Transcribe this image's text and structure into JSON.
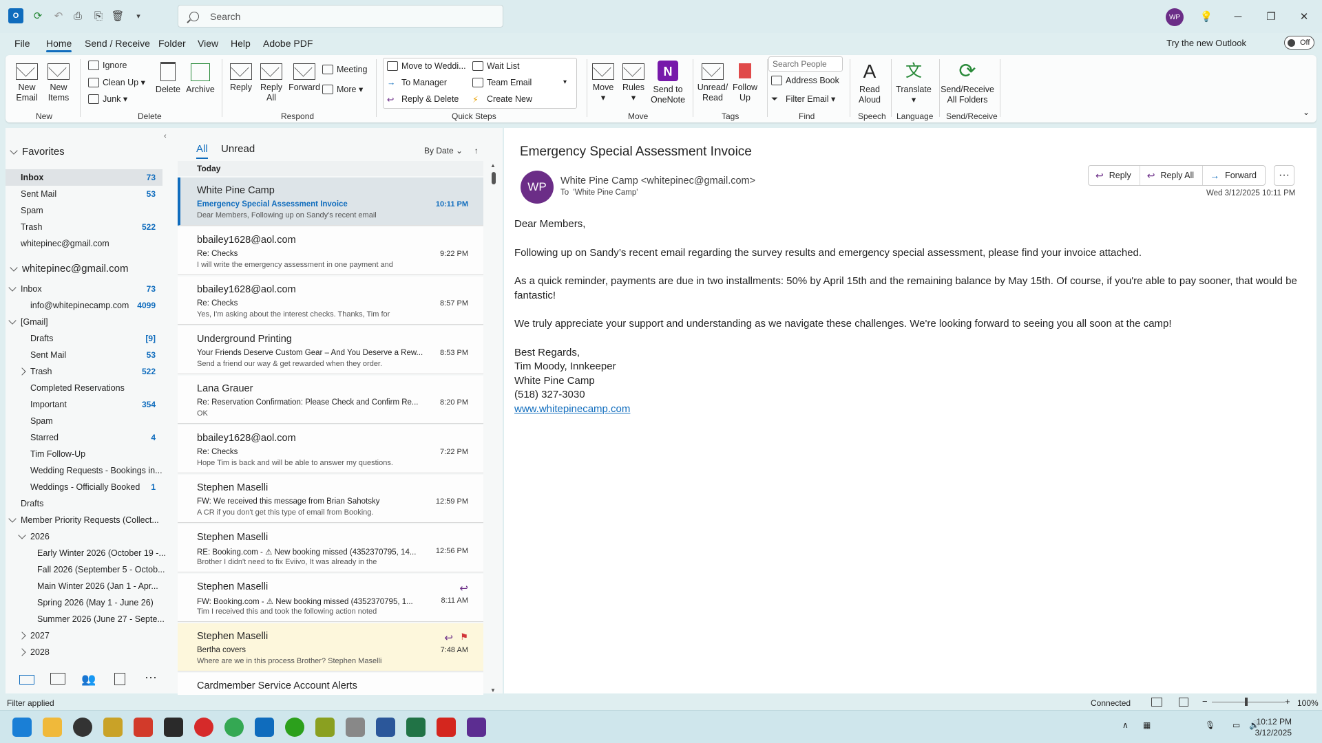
{
  "titlebar": {
    "search_placeholder": "Search",
    "avatar_initials": "WP"
  },
  "menu": {
    "items": [
      "File",
      "Home",
      "Send / Receive",
      "Folder",
      "View",
      "Help",
      "Adobe PDF"
    ],
    "active": "Home",
    "try_new": "Try the new Outlook",
    "toggle": "Off"
  },
  "ribbon": {
    "new_email": "New\nEmail",
    "new_items": "New\nItems",
    "ignore": "Ignore",
    "clean_up": "Clean Up",
    "junk": "Junk",
    "delete": "Delete",
    "archive": "Archive",
    "reply": "Reply",
    "reply_all": "Reply\nAll",
    "forward": "Forward",
    "meeting": "Meeting",
    "more": "More",
    "qs_move": "Move to Weddi...",
    "qs_manager": "To Manager",
    "qs_reply_delete": "Reply & Delete",
    "qs_wait": "Wait List",
    "qs_team": "Team Email",
    "qs_create": "Create New",
    "move": "Move",
    "rules": "Rules",
    "onenote": "Send to\nOneNote",
    "unread": "Unread/\nRead",
    "follow": "Follow\nUp",
    "search_people": "Search People",
    "address_book": "Address Book",
    "filter_email": "Filter Email",
    "read_aloud": "Read\nAloud",
    "translate": "Translate",
    "send_receive": "Send/Receive\nAll Folders",
    "groups": [
      "New",
      "Delete",
      "Respond",
      "Quick Steps",
      "Move",
      "Tags",
      "Find",
      "Speech",
      "Language",
      "Send/Receive"
    ]
  },
  "nav": {
    "favorites": "Favorites",
    "fav_items": [
      {
        "label": "Inbox",
        "count": "73"
      },
      {
        "label": "Sent Mail",
        "count": "53"
      },
      {
        "label": "Spam",
        "count": ""
      },
      {
        "label": "Trash",
        "count": "522"
      },
      {
        "label": "whitepinec@gmail.com",
        "count": ""
      }
    ],
    "account": "whitepinec@gmail.com",
    "acct_items": [
      {
        "label": "Inbox",
        "count": "73"
      },
      {
        "label": "info@whitepinecamp.com",
        "count": "4099"
      },
      {
        "label": "[Gmail]",
        "count": ""
      },
      {
        "label": "Drafts",
        "count": "[9]"
      },
      {
        "label": "Sent Mail",
        "count": "53"
      },
      {
        "label": "Trash",
        "count": "522"
      },
      {
        "label": "Completed Reservations",
        "count": ""
      },
      {
        "label": "Important",
        "count": "354"
      },
      {
        "label": "Spam",
        "count": ""
      },
      {
        "label": "Starred",
        "count": "4"
      },
      {
        "label": "Tim Follow-Up",
        "count": ""
      },
      {
        "label": "Wedding Requests - Bookings in...",
        "count": ""
      },
      {
        "label": "Weddings - Officially Booked",
        "count": "1"
      },
      {
        "label": "Drafts",
        "count": ""
      },
      {
        "label": "Member Priority Requests (Collect...",
        "count": ""
      },
      {
        "label": "2026",
        "count": ""
      },
      {
        "label": "Early Winter 2026 (October 19 -...",
        "count": ""
      },
      {
        "label": "Fall 2026 (September 5 - Octob...",
        "count": ""
      },
      {
        "label": "Main Winter 2026 (Jan 1 - Apr...",
        "count": ""
      },
      {
        "label": "Spring 2026 (May 1 - June 26)",
        "count": ""
      },
      {
        "label": "Summer 2026 (June 27 - Septe...",
        "count": ""
      },
      {
        "label": "2027",
        "count": ""
      },
      {
        "label": "2028",
        "count": ""
      }
    ]
  },
  "list": {
    "tab_all": "All",
    "tab_unread": "Unread",
    "sort": "By Date",
    "group_today": "Today",
    "messages": [
      {
        "sender": "White Pine Camp",
        "subject": "Emergency Special Assessment Invoice",
        "preview": "Dear Members,  Following up on Sandy's recent email",
        "time": "10:11 PM"
      },
      {
        "sender": "bbailey1628@aol.com",
        "subject": "Re: Checks",
        "preview": "I will write the emergency assessment in one payment  and",
        "time": "9:22 PM"
      },
      {
        "sender": "bbailey1628@aol.com",
        "subject": "Re: Checks",
        "preview": "Yes, I'm asking about the interest checks.  Thanks, Tim for",
        "time": "8:57 PM"
      },
      {
        "sender": "Underground Printing",
        "subject": "Your Friends Deserve Custom Gear – And You Deserve a Rew...",
        "preview": "Send a friend our way & get rewarded when they order.",
        "time": "8:53 PM"
      },
      {
        "sender": "Lana Grauer",
        "subject": "Re: Reservation Confirmation: Please Check and Confirm Re...",
        "preview": "OK",
        "time": "8:20 PM"
      },
      {
        "sender": "bbailey1628@aol.com",
        "subject": "Re: Checks",
        "preview": "Hope Tim is back and will be able to answer my questions.",
        "time": "7:22 PM"
      },
      {
        "sender": "Stephen Maselli",
        "subject": "FW: We received this message from Brian Sahotsky",
        "preview": "A CR if you don't get this type of email from Booking.",
        "time": "12:59 PM"
      },
      {
        "sender": "Stephen Maselli",
        "subject": "RE: Booking.com - ⚠ New booking missed (4352370795, 14...",
        "preview": "Brother I didn't need to fix Eviivo,  It was already in the",
        "time": "12:56 PM"
      },
      {
        "sender": "Stephen Maselli",
        "subject": "FW: Booking.com - ⚠ New booking missed (4352370795, 1...",
        "preview": "Tim I received this and took the following action noted",
        "time": "8:11 AM"
      },
      {
        "sender": "Stephen Maselli",
        "subject": "Bertha covers",
        "preview": "Where are we in this process Brother?  Stephen Maselli",
        "time": "7:48 AM"
      },
      {
        "sender": "Cardmember Service Account Alerts",
        "subject": "",
        "preview": "",
        "time": ""
      }
    ]
  },
  "reading": {
    "subject": "Emergency Special Assessment Invoice",
    "avatar": "WP",
    "from": "White Pine Camp <whitepinec@gmail.com>",
    "to_label": "To",
    "to": "'White Pine Camp'",
    "reply": "Reply",
    "reply_all": "Reply All",
    "forward": "Forward",
    "date": "Wed 3/12/2025 10:11 PM",
    "greeting": "Dear Members,",
    "p1": "Following up on Sandy’s recent email regarding the survey results and emergency special assessment, please find your invoice attached.",
    "p2": "As a quick reminder, payments are due in two installments: 50% by April 15th and the remaining balance by May 15th. Of course, if you're able to pay sooner, that would be fantastic!",
    "p3": "We truly appreciate your support and understanding as we navigate these challenges. We're looking forward to seeing you all soon at the camp!",
    "sig1": "Best Regards,",
    "sig2": "Tim Moody, Innkeeper",
    "sig3": "White Pine Camp",
    "sig4": "(518) 327-3030",
    "link": "www.whitepinecamp.com"
  },
  "status": {
    "filter": "Filter applied",
    "connected": "Connected",
    "zoom": "100%"
  },
  "taskbar": {
    "time": "10:12 PM",
    "date": "3/12/2025"
  },
  "colors": {
    "accent": "#0f6cbd",
    "avatar": "#6b2d87",
    "flag_bg": "#fdf7dc"
  }
}
